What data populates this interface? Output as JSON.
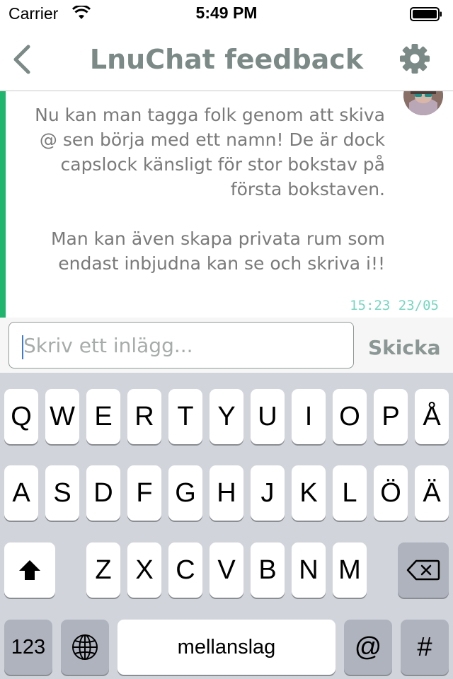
{
  "status_bar": {
    "carrier": "Carrier",
    "time": "5:49 PM"
  },
  "nav": {
    "title": "LnuChat feedback",
    "back_icon": "chevron-left-icon",
    "settings_icon": "gear-icon"
  },
  "message": {
    "paragraphs": [
      "Nu kan man tagga folk genom att skiva @ sen börja med ett namn! De är dock capslock känsligt för stor bokstav på första bokstaven.",
      "Man kan även skapa privata rum som endast inbjudna kan se och skriva i!!"
    ],
    "timestamp": "15:23 23/05"
  },
  "composer": {
    "placeholder": "Skriv ett inlägg...",
    "send_label": "Skicka"
  },
  "keyboard": {
    "row1": [
      "Q",
      "W",
      "E",
      "R",
      "T",
      "Y",
      "U",
      "I",
      "O",
      "P",
      "Å"
    ],
    "row2": [
      "A",
      "S",
      "D",
      "F",
      "G",
      "H",
      "J",
      "K",
      "L",
      "Ö",
      "Ä"
    ],
    "row3": [
      "Z",
      "X",
      "C",
      "V",
      "B",
      "N",
      "M"
    ],
    "numbers_label": "123",
    "space_label": "mellanslag",
    "at_label": "@",
    "hash_label": "#"
  },
  "colors": {
    "accent_green": "#1fb56f",
    "title_gray": "#7b8a86",
    "timestamp_teal": "#76d6c0"
  }
}
